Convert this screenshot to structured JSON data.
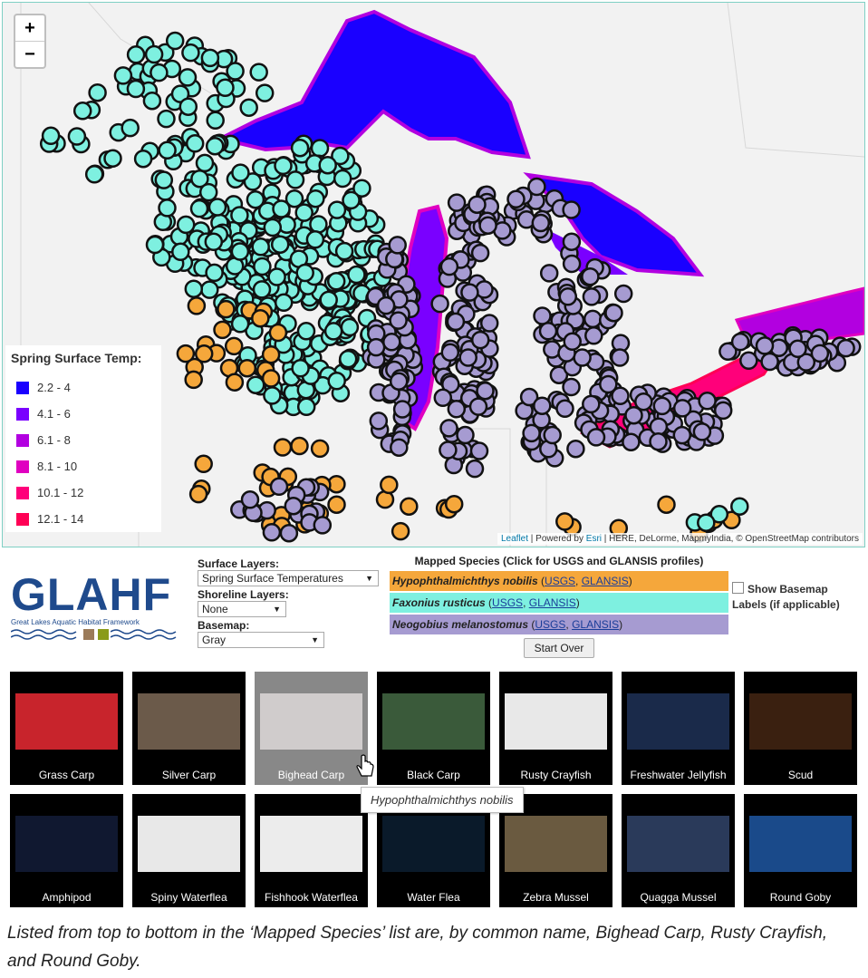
{
  "map": {
    "zoom_in": "+",
    "zoom_out": "−",
    "legend": {
      "title": "Spring Surface Temp:",
      "items": [
        {
          "label": "2.2 - 4",
          "color": "#1a00ff"
        },
        {
          "label": "4.1 - 6",
          "color": "#7a00ff"
        },
        {
          "label": "6.1 - 8",
          "color": "#b200e0"
        },
        {
          "label": "8.1 - 10",
          "color": "#e000c0"
        },
        {
          "label": "10.1 - 12",
          "color": "#ff007a"
        },
        {
          "label": "12.1 - 14",
          "color": "#ff0055"
        }
      ]
    },
    "attribution": {
      "leaflet": "Leaflet",
      "powered": " | Powered by ",
      "esri": "Esri",
      "rest": " | HERE, DeLorme, MapmyIndia, © OpenStreetMap contributors"
    },
    "marker_colors": {
      "bighead": "#f5a73b",
      "crayfish": "#7ef0e0",
      "goby": "#a69bd1"
    }
  },
  "logo": {
    "title": "GLAHF",
    "subtitle": "Great Lakes Aquatic Habitat Framework"
  },
  "controls": {
    "surface_label": "Surface Layers:",
    "surface_value": "Spring Surface Temperatures",
    "shoreline_label": "Shoreline Layers:",
    "shoreline_value": "None",
    "basemap_label": "Basemap:",
    "basemap_value": "Gray"
  },
  "species": {
    "header": "Mapped Species (Click for USGS and GLANSIS profiles)",
    "items": [
      {
        "name": "Hypophthalmichthys nobilis",
        "usgs": "USGS",
        "glansis": "GLANSIS",
        "color": "#f5a73b"
      },
      {
        "name": "Faxonius rusticus",
        "usgs": "USGS",
        "glansis": "GLANSIS",
        "color": "#7ef0e0"
      },
      {
        "name": "Neogobius melanostomus",
        "usgs": "USGS",
        "glansis": "GLANSIS",
        "color": "#a69bd1"
      }
    ],
    "start_over": "Start Over"
  },
  "basemap_labels": {
    "line1": "Show Basemap",
    "line2": "Labels (if applicable)"
  },
  "thumbnails": [
    "Grass Carp",
    "Silver Carp",
    "Bighead Carp",
    "Black Carp",
    "Rusty Crayfish",
    "Freshwater Jellyfish",
    "Scud",
    "Amphipod",
    "Spiny Waterflea",
    "Fishhook Waterflea",
    "Water Flea",
    "Zebra Mussel",
    "Quagga Mussel",
    "Round Goby"
  ],
  "tooltip": "Hypophthalmichthys nobilis",
  "caption": "Listed from top to bottom in the ‘Mapped Species’ list are, by common name, Bighead Carp, Rusty Crayfish, and Round Goby."
}
